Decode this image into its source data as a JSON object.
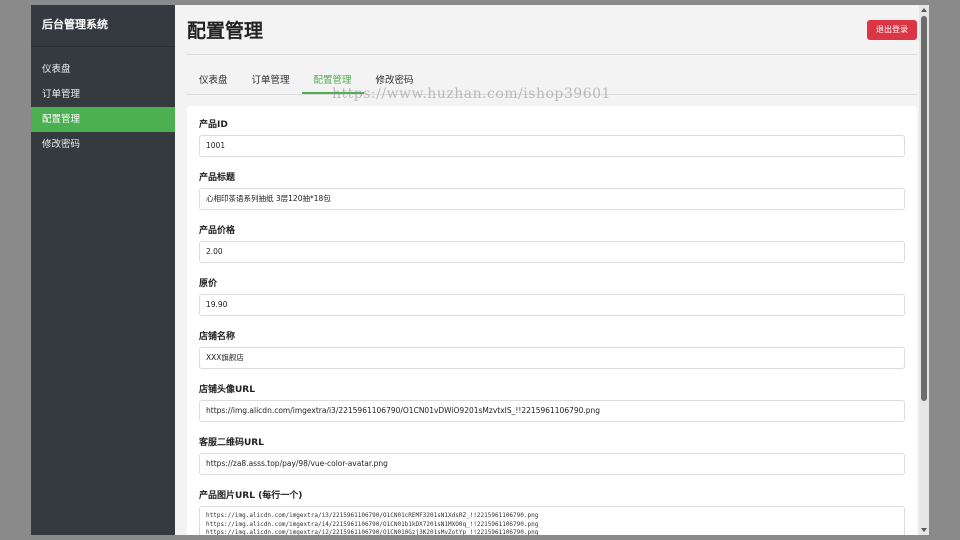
{
  "sidebar": {
    "brand": "后台管理系统",
    "items": [
      {
        "label": "仪表盘"
      },
      {
        "label": "订单管理"
      },
      {
        "label": "配置管理"
      },
      {
        "label": "修改密码"
      }
    ],
    "active_index": 2
  },
  "header": {
    "title": "配置管理",
    "logout_label": "退出登录"
  },
  "tabs": [
    {
      "label": "仪表盘"
    },
    {
      "label": "订单管理"
    },
    {
      "label": "配置管理"
    },
    {
      "label": "修改密码"
    }
  ],
  "watermark": "https://www.huzhan.com/ishop39601",
  "form": {
    "product_id": {
      "label": "产品ID",
      "value": "1001"
    },
    "product_title": {
      "label": "产品标题",
      "value": "心相印茶语系列抽纸 3层120抽*18包"
    },
    "product_price": {
      "label": "产品价格",
      "value": "2.00"
    },
    "original_price": {
      "label": "原价",
      "value": "19.90"
    },
    "shop_name": {
      "label": "店铺名称",
      "value": "XXX旗舰店"
    },
    "shop_avatar_url": {
      "label": "店铺头像URL",
      "value": "https://img.alicdn.com/imgextra/i3/2215961106790/O1CN01vDWiO9201sMzvtxIS_!!2215961106790.png"
    },
    "service_qr_url": {
      "label": "客服二维码URL",
      "value": "https://za8.asss.top/pay/98/vue-color-avatar.png"
    },
    "product_images": {
      "label": "产品图片URL (每行一个)",
      "value": "https://img.alicdn.com/imgextra/i3/2215961106790/O1CN01cREMF3201sN1XdsRZ_!!2215961106790.png\nhttps://img.alicdn.com/imgextra/i4/2215961106790/O1CN01b1kDX7201sN1MXO0q_!!2215961106790.png\nhttps://img.alicdn.com/imgextra/i2/2215961106790/O1CN010Gzj3K201sMvZotYp_!!2215961106790.png"
    }
  },
  "colors": {
    "sidebar_bg": "#343a40",
    "accent": "#4caf50",
    "danger": "#dc3545"
  }
}
